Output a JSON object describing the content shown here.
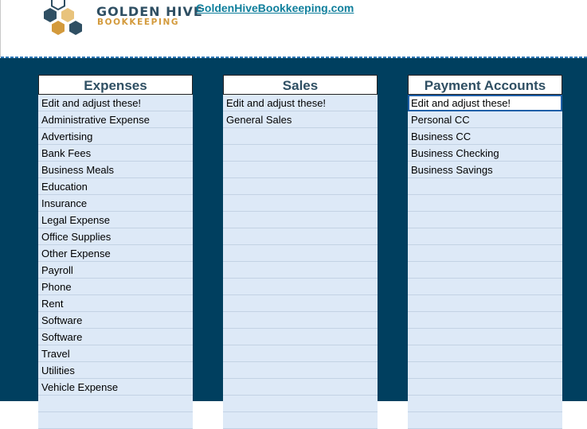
{
  "brand": {
    "name": "GOLDEN HIVE",
    "subtitle": "BOOKKEEPING",
    "link_text": "GoldenHiveBookkeeping.com"
  },
  "colors": {
    "panel_bg": "#003f5f",
    "cell_bg": "#dde9f7",
    "heading_text": "#2f4f63",
    "accent_gold": "#d39a3c",
    "link": "#0f7f9c"
  },
  "columns": [
    {
      "title": "Expenses",
      "items": [
        "Edit and adjust these!",
        "Administrative Expense",
        "Advertising",
        "Bank Fees",
        "Business Meals",
        "Education",
        "Insurance",
        "Legal Expense",
        "Office Supplies",
        "Other Expense",
        "Payroll",
        "Phone",
        "Rent",
        "Software",
        "Software",
        "Travel",
        "Utilities",
        "Vehicle Expense",
        "",
        ""
      ]
    },
    {
      "title": "Sales",
      "items": [
        "Edit and adjust these!",
        "General Sales",
        "",
        "",
        "",
        "",
        "",
        "",
        "",
        "",
        "",
        "",
        "",
        "",
        "",
        "",
        "",
        "",
        "",
        ""
      ]
    },
    {
      "title": "Payment Accounts",
      "items": [
        "Edit and adjust these!",
        "Personal CC",
        "Business CC",
        "Business Checking",
        "Business Savings",
        "",
        "",
        "",
        "",
        "",
        "",
        "",
        "",
        "",
        "",
        "",
        "",
        "",
        "",
        ""
      ]
    }
  ]
}
